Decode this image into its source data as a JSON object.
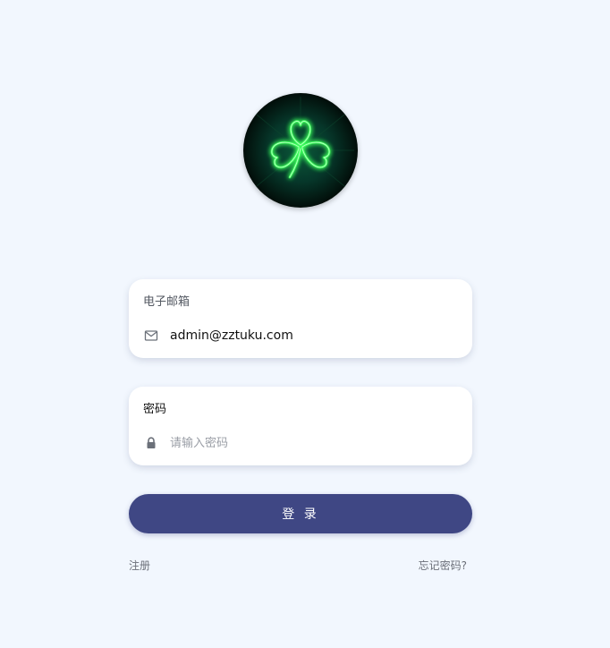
{
  "logo": {
    "icon": "neon-clover-icon",
    "colors": {
      "neon": "#39ff5a",
      "background": "#04281c"
    }
  },
  "email": {
    "label": "电子邮箱",
    "value": "admin@zztuku.com",
    "icon": "mail-icon"
  },
  "password": {
    "label": "密码",
    "placeholder": "请输入密码",
    "icon": "lock-icon"
  },
  "login_button": {
    "label": "登 录",
    "color": "#3f4784"
  },
  "links": {
    "register": "注册",
    "forgot_password": "忘记密码?"
  },
  "colors": {
    "page_background": "#f2f7fe",
    "card_background": "#ffffff"
  }
}
